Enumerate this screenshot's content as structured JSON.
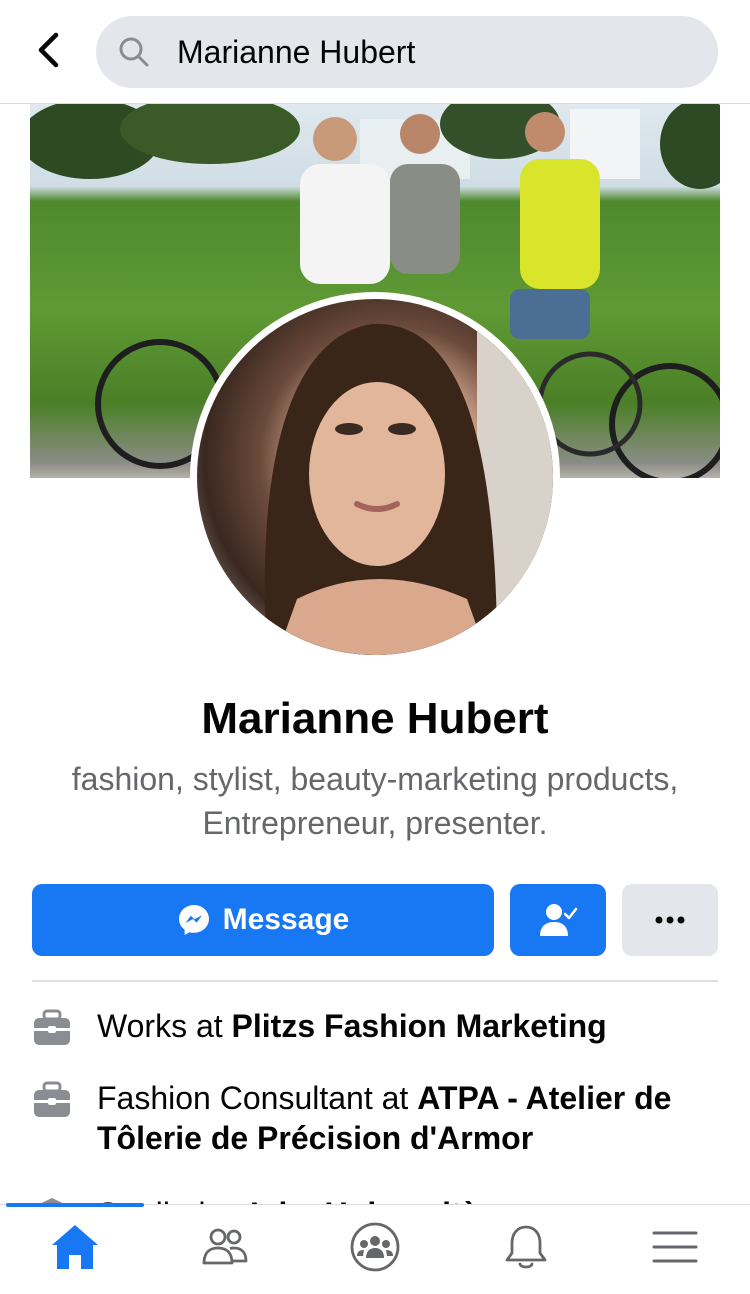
{
  "header": {
    "back_icon": "chevron-left-icon",
    "search_icon": "search-icon",
    "search_value": "Marianne Hubert"
  },
  "profile": {
    "cover_photo": "cover-photo",
    "profile_photo": "profile-photo",
    "name": "Marianne Hubert",
    "bio_line1": "fashion, stylist,  beauty-marketing products,",
    "bio_line2": "Entrepreneur,  presenter."
  },
  "actions": {
    "message_label": "Message",
    "message_icon": "messenger-icon",
    "friend_icon": "friends-check-icon",
    "more_icon": "more-dots-icon",
    "accent_color": "#1877f2"
  },
  "details": [
    {
      "icon": "briefcase-icon",
      "prefix": "Works at ",
      "bold": "Plitzs Fashion Marketing"
    },
    {
      "icon": "briefcase-icon",
      "prefix": "Fashion Consultant at ",
      "bold": "ATPA - Atelier de Tôlerie de Précision d'Armor"
    },
    {
      "icon": "graduation-cap-icon",
      "prefix": "Studied at ",
      "bold": "Iulm Università"
    }
  ],
  "tabbar": {
    "tabs": [
      {
        "name": "home",
        "icon": "home-icon",
        "active": true
      },
      {
        "name": "friends",
        "icon": "friends-icon",
        "active": false
      },
      {
        "name": "groups",
        "icon": "groups-icon",
        "active": false
      },
      {
        "name": "notifications",
        "icon": "bell-icon",
        "active": false
      },
      {
        "name": "menu",
        "icon": "hamburger-menu-icon",
        "active": false
      }
    ]
  }
}
